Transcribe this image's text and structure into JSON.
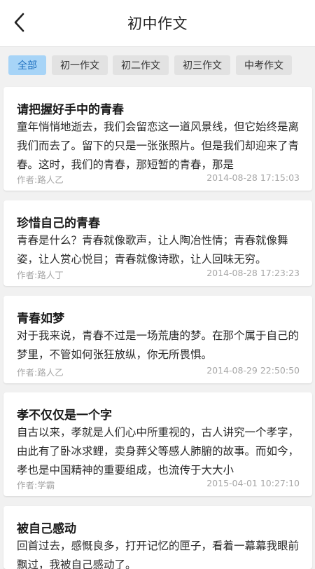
{
  "header": {
    "title": "初中作文"
  },
  "tabs": [
    {
      "label": "全部",
      "active": true
    },
    {
      "label": "初一作文",
      "active": false
    },
    {
      "label": "初二作文",
      "active": false
    },
    {
      "label": "初三作文",
      "active": false
    },
    {
      "label": "中考作文",
      "active": false
    }
  ],
  "colors": {
    "active_tab_bg": "#a7d4f7",
    "active_tab_text": "#1e6fbf",
    "page_bg": "#f1f1f1"
  },
  "articles": [
    {
      "title": "请把握好手中的青春",
      "excerpt": "童年悄悄地逝去，我们会留恋这一道风景线，但它始终是离我们而去了。留下的只是一张张照片。但是我们却迎来了青春。这时，我们的青春，那短暂的青春，那是",
      "author": "作者:路人乙",
      "date": "2014-08-28 17:15:03"
    },
    {
      "title": "珍惜自己的青春",
      "excerpt": "青春是什么？青春就像歌声，让人陶冶性情；青春就像舞姿，让人赏心悦目；青春就像诗歌，让人回味无穷。",
      "author": "作者:路人丁",
      "date": "2014-08-28 17:23:23"
    },
    {
      "title": "青春如梦",
      "excerpt": "对于我来说，青春不过是一场荒唐的梦。在那个属于自己的梦里，不管如何张狂放纵，你无所畏惧。",
      "author": "作者:路人乙",
      "date": "2014-08-29 22:50:50"
    },
    {
      "title": "孝不仅仅是一个字",
      "excerpt": "自古以来，孝就是人们心中所重视的，古人讲究一个孝字，由此有了卧冰求鲤，卖身葬父等感人肺腑的故事。而如今，孝也是中国精神的重要组成，也流传于大大小",
      "author": "作者:学霸",
      "date": "2015-04-01 10:27:10"
    },
    {
      "title": "被自己感动",
      "excerpt": "回首过去，感慨良多，打开记忆的匣子，看着一幕幕我眼前飘过，我被自己感动了。",
      "author": "",
      "date": ""
    }
  ]
}
